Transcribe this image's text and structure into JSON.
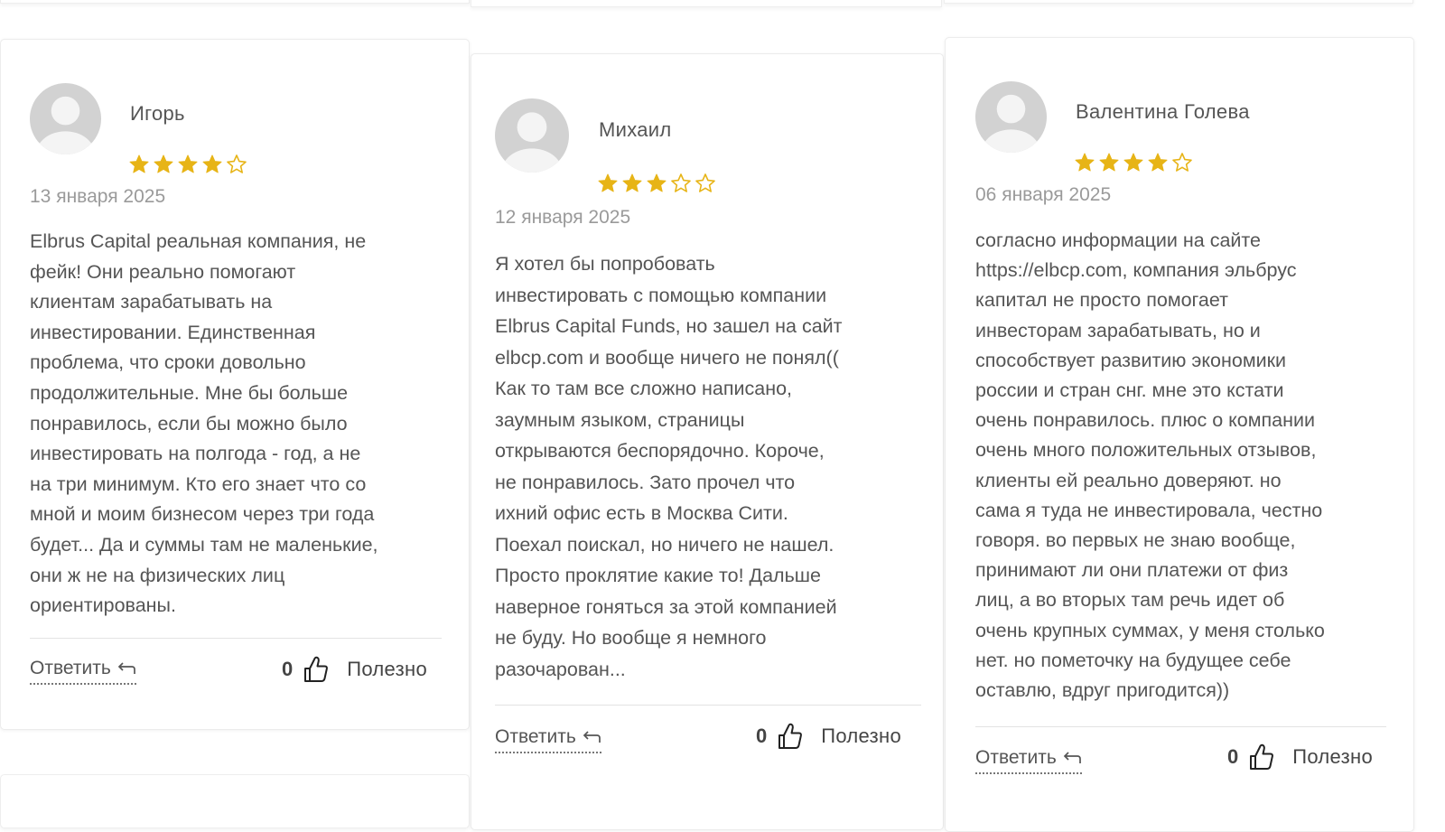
{
  "colors": {
    "star": "#e7b416",
    "avatar": "#d2d2d2",
    "text": "#555555",
    "date": "#9a9a9a"
  },
  "reviews": [
    {
      "name": "Игорь",
      "rating": 4,
      "max_rating": 5,
      "date": "13 января 2025",
      "text": "Elbrus Capital реальная компания, не\nфейк! Они реально помогают\nклиентам зарабатывать на\nинвестировании. Единственная\nпроблема, что сроки довольно\nпродолжительные. Мне бы больше\nпонравилось, если бы можно было\nинвестировать на полгода - год, а не\nна три минимум. Кто его знает что со\nмной и моим бизнесом через три года\nбудет... Да и суммы там не маленькие,\nони ж не на физических лиц\nориентированы.",
      "reply_label": "Ответить",
      "likes": "0",
      "helpful_label": "Полезно"
    },
    {
      "name": "Михаил",
      "rating": 3,
      "max_rating": 5,
      "date": "12 января 2025",
      "text": "Я хотел бы попробовать\nинвестировать с помощью компании\nElbrus Capital Funds, но зашел на сайт\nelbcp.com и вообще ничего не понял((\nКак то там все сложно написано,\nзаумным языком, страницы\nоткрываются беспорядочно. Короче,\nне понравилось. Зато прочел что\nихний офис есть в Москва Сити.\nПоехал поискал, но ничего не нашел.\nПросто проклятие какие то! Дальше\nнаверное гоняться за этой компанией\nне буду. Но вообще я немного\nразочарован...",
      "reply_label": "Ответить",
      "likes": "0",
      "helpful_label": "Полезно"
    },
    {
      "name": "Валентина Голева",
      "rating": 4,
      "max_rating": 5,
      "date": "06 января 2025",
      "text": "согласно информации на сайте\nhttps://elbcp.com, компания эльбрус\nкапитал не просто помогает\nинвесторам зарабатывать, но и\nспособствует развитию экономики\nроссии и стран снг. мне это кстати\nочень понравилось. плюс о компании\nочень много положительных отзывов,\nклиенты ей реально доверяют. но\nсама я туда не инвестировала, честно\nговоря. во первых не знаю вообще,\nпринимают ли они платежи от физ\nлиц, а во вторых там речь идет об\nочень крупных суммах, у меня столько\nнет. но пометочку на будущее себе\nоставлю, вдруг пригодится))",
      "reply_label": "Ответить",
      "likes": "0",
      "helpful_label": "Полезно"
    }
  ]
}
